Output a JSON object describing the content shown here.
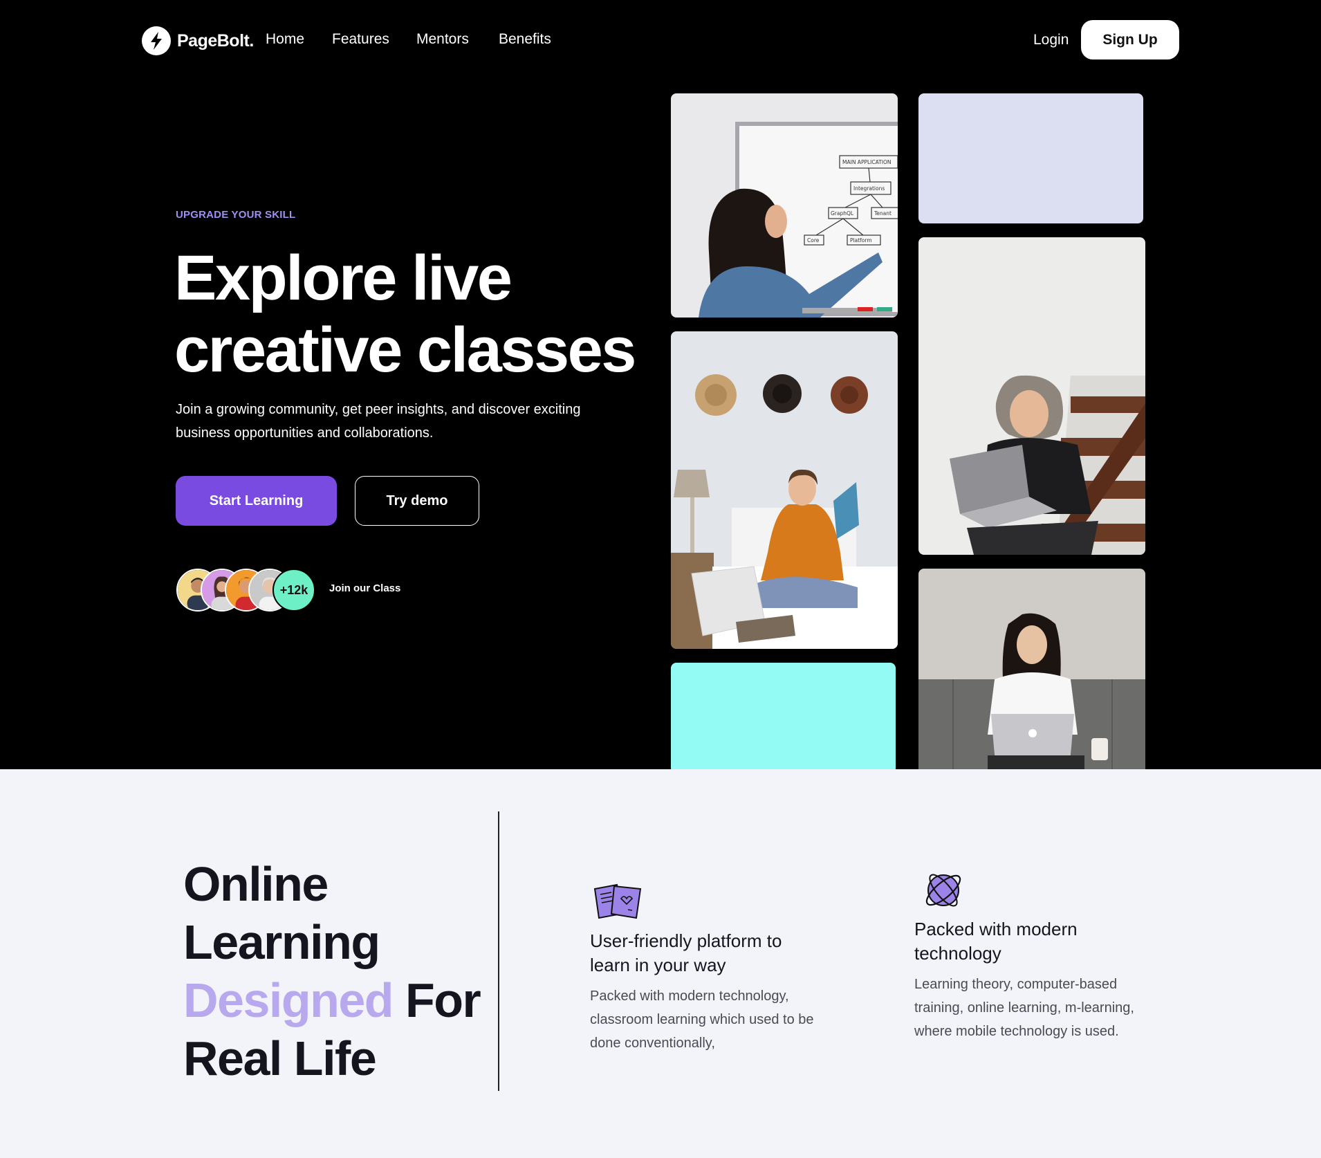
{
  "brand": {
    "name": "PageBolt."
  },
  "nav": {
    "links": [
      "Home",
      "Features",
      "Mentors",
      "Benefits"
    ],
    "login": "Login",
    "signup": "Sign Up"
  },
  "hero": {
    "eyebrow": "UPGRADE YOUR SKILL",
    "headline_line1": "Explore live",
    "headline_line2": "creative classes",
    "subtext": "Join a growing community, get peer insights, and discover exciting business opportunities and collaborations.",
    "primary_cta": "Start Learning",
    "secondary_cta": "Try demo",
    "member_count": "+12k",
    "join_label": "Join our Class"
  },
  "gallery": {
    "whiteboard_text": [
      "MAIN APPLICATION",
      "Integrations",
      "GraphQL",
      "Tenant",
      "Core",
      "Platform"
    ]
  },
  "about": {
    "title_line1": "Online",
    "title_line2": "Learning",
    "title_accent": "Designed",
    "title_line3_rest": "For",
    "title_line4": "Real Life",
    "features": [
      {
        "icon": "document-cards-icon",
        "title": "User-friendly platform to learn in your way",
        "description": "Packed with modern technology, classroom learning which used to be done conventionally,"
      },
      {
        "icon": "planet-orbit-icon",
        "title": "Packed with modern technology",
        "description": "Learning theory, computer-based training, online learning, m-learning, where mobile technology is used."
      }
    ]
  },
  "colors": {
    "accent_purple": "#7a4be0",
    "eyebrow_purple": "#a08ef0",
    "title_accent": "#b8a9ef",
    "mint": "#6ef0c6",
    "cyan_tile": "#93fbf4",
    "lavender_tile": "#dcdff2"
  }
}
